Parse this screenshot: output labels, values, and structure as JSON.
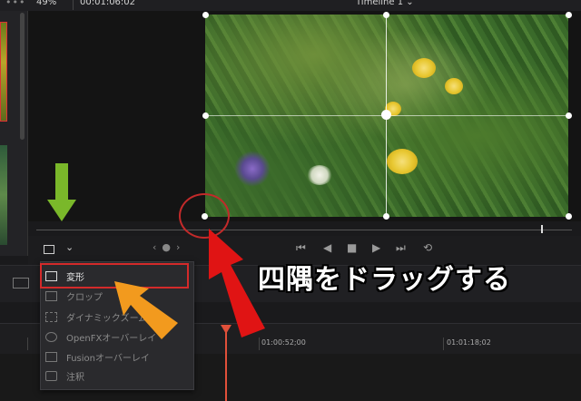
{
  "topbar": {
    "menu_dots": "•••",
    "zoom": "49%",
    "timecode": "00:01:06:02",
    "timeline_name": "Timeline 1 ⌄"
  },
  "viewer": {
    "transform_chevron": "⌄",
    "nav": "‹●›"
  },
  "transport": {
    "first": "⏮",
    "prev": "◀",
    "stop": "■",
    "play": "▶",
    "last": "⏭",
    "loop": "⟲"
  },
  "menu": {
    "items": [
      {
        "label": "変形",
        "icon": "transform-icon",
        "selected": true
      },
      {
        "label": "クロップ",
        "icon": "crop-icon",
        "selected": false
      },
      {
        "label": "ダイナミックズーム",
        "icon": "dynamic-zoom-icon",
        "selected": false
      },
      {
        "label": "OpenFXオーバーレイ",
        "icon": "fx-icon",
        "selected": false
      },
      {
        "label": "Fusionオーバーレイ",
        "icon": "fusion-icon",
        "selected": false
      },
      {
        "label": "注釈",
        "icon": "annotation-icon",
        "selected": false
      }
    ]
  },
  "timeline": {
    "timecodes": [
      "01:00:52;00",
      "01:01:18;02"
    ]
  },
  "annotation": {
    "caption": "四隅をドラッグする"
  },
  "colors": {
    "highlight_red": "#d42a2a",
    "arrow_green": "#7ab82a",
    "arrow_orange": "#f29a1e",
    "arrow_red": "#e01414",
    "playhead": "#e0503a"
  }
}
